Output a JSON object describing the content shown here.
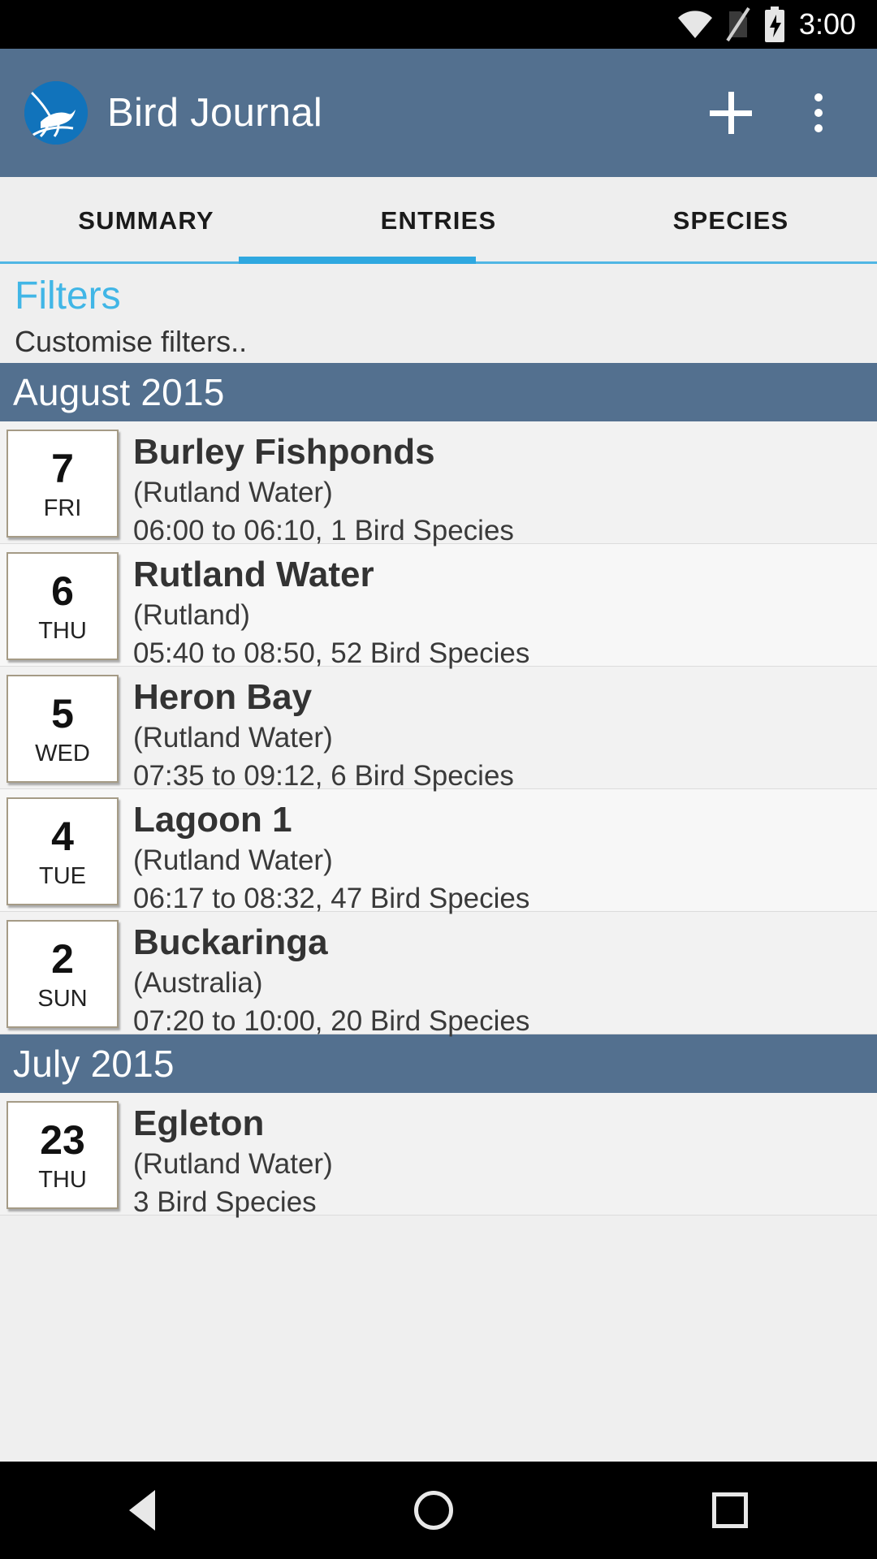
{
  "status_bar": {
    "time": "3:00",
    "icons": [
      "wifi-icon",
      "sim-card-off-icon",
      "battery-charging-icon"
    ]
  },
  "app_bar": {
    "title": "Bird Journal",
    "logo_icon": "bird-logo-icon",
    "add_icon": "plus-icon",
    "overflow_icon": "overflow-menu-icon",
    "background_color": "#53708f"
  },
  "tabs": {
    "items": [
      {
        "label": "SUMMARY",
        "selected": false
      },
      {
        "label": "ENTRIES",
        "selected": true
      },
      {
        "label": "SPECIES",
        "selected": false
      }
    ],
    "indicator_color": "#2fa8e0",
    "underline_color": "#50b6e4"
  },
  "filters": {
    "title": "Filters",
    "subtitle": "Customise filters..",
    "title_color": "#41b6e6"
  },
  "sections": [
    {
      "month": "August 2015",
      "entries": [
        {
          "day": "7",
          "dow": "FRI",
          "title": "Burley Fishponds",
          "location": "(Rutland Water)",
          "meta": "06:00 to 06:10, 1 Bird Species"
        },
        {
          "day": "6",
          "dow": "THU",
          "title": "Rutland Water",
          "location": "(Rutland)",
          "meta": "05:40 to 08:50, 52 Bird Species"
        },
        {
          "day": "5",
          "dow": "WED",
          "title": "Heron Bay",
          "location": "(Rutland Water)",
          "meta": "07:35 to 09:12, 6 Bird Species"
        },
        {
          "day": "4",
          "dow": "TUE",
          "title": "Lagoon 1",
          "location": "(Rutland Water)",
          "meta": "06:17 to 08:32, 47 Bird Species"
        },
        {
          "day": "2",
          "dow": "SUN",
          "title": "Buckaringa",
          "location": "(Australia)",
          "meta": "07:20 to 10:00, 20 Bird Species"
        }
      ]
    },
    {
      "month": "July 2015",
      "entries": [
        {
          "day": "23",
          "dow": "THU",
          "title": "Egleton",
          "location": "(Rutland Water)",
          "meta": "3 Bird Species"
        }
      ]
    }
  ],
  "nav_bar": {
    "back_icon": "back-triangle-icon",
    "home_icon": "home-circle-icon",
    "recents_icon": "recents-square-icon"
  }
}
